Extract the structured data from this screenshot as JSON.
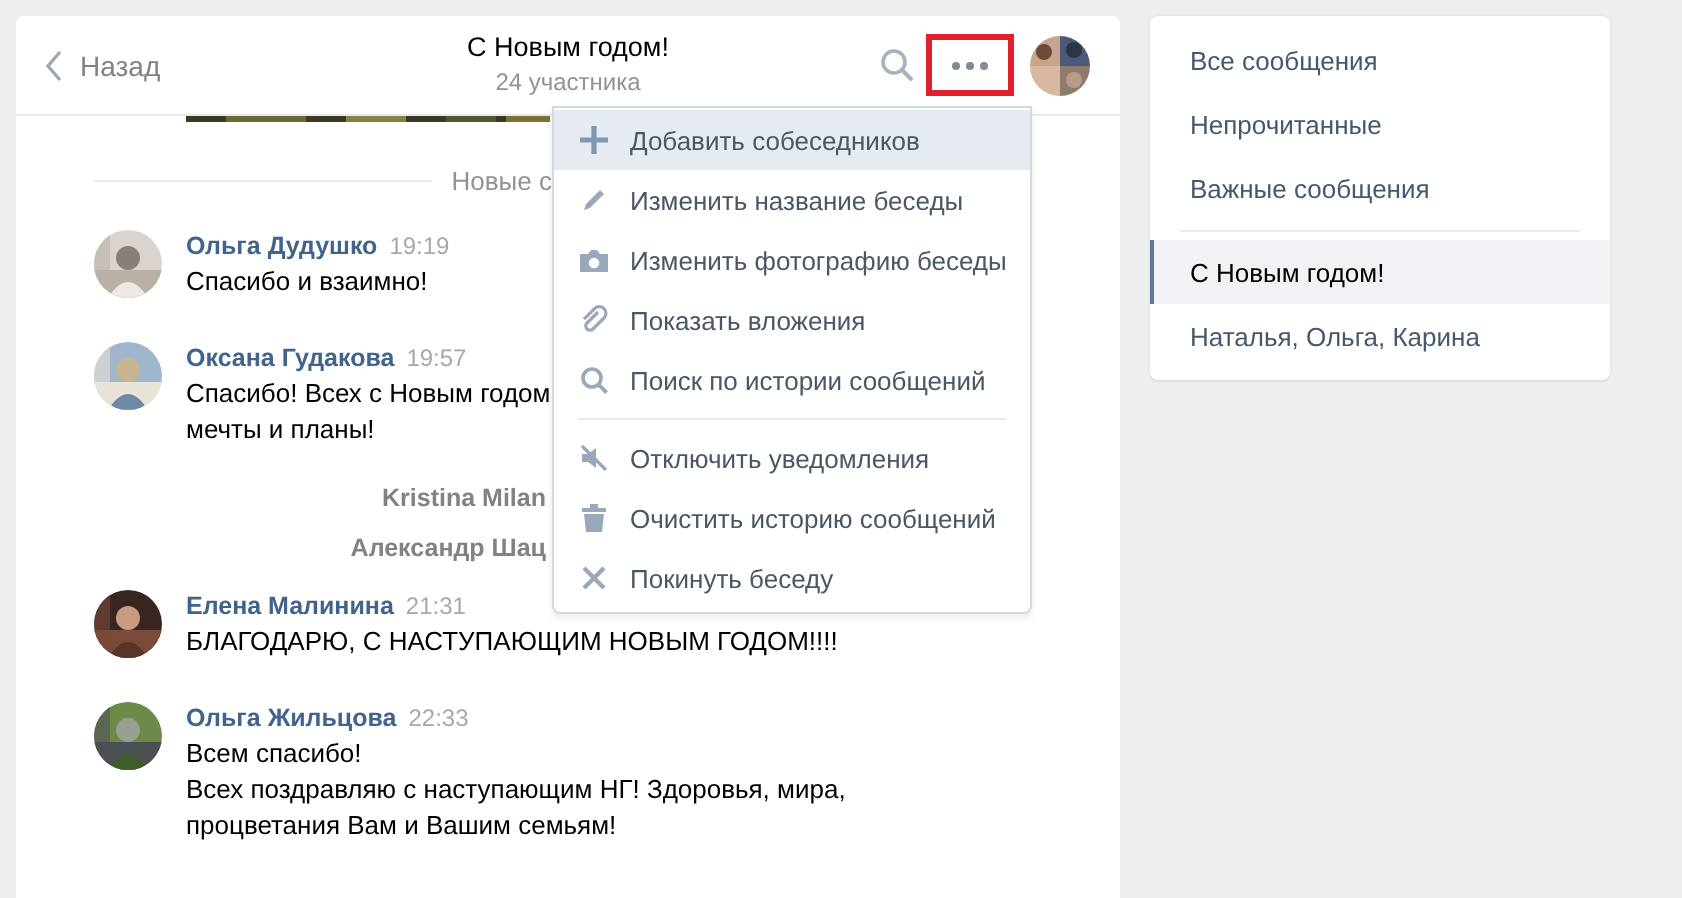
{
  "header": {
    "back": "Назад",
    "title": "С Новым годом!",
    "subtitle": "24 участника",
    "more_button": {
      "highlighted": true
    }
  },
  "new_divider": "Новые с",
  "messages": [
    {
      "kind": "message",
      "author": "Ольга Дудушко",
      "time": "19:19",
      "lines": [
        "Спасибо и взаимно!"
      ]
    },
    {
      "kind": "message",
      "author": "Оксана Гудакова",
      "time": "19:57",
      "lines": [
        "Спасибо! Всех с Новым годом",
        "мечты и планы!"
      ]
    },
    {
      "kind": "service",
      "author": "Kristina Milan"
    },
    {
      "kind": "service",
      "author": "Александр Шац"
    },
    {
      "kind": "message",
      "author": "Елена Малинина",
      "time": "21:31",
      "lines": [
        "БЛАГОДАРЮ, С НАСТУПАЮЩИМ НОВЫМ ГОДОМ!!!!"
      ]
    },
    {
      "kind": "message",
      "author": "Ольга Жильцова",
      "time": "22:33",
      "lines": [
        "Всем спасибо!",
        "Всех поздравляю с наступающим НГ! Здоровья, мира,",
        "процветания Вам и Вашим семьям!"
      ]
    }
  ],
  "menu": {
    "groups": [
      [
        {
          "label": "Добавить собеседников",
          "selected": true
        },
        {
          "label": "Изменить название беседы",
          "selected": false
        },
        {
          "label": "Изменить фотографию беседы",
          "selected": false
        },
        {
          "label": "Показать вложения",
          "selected": false
        },
        {
          "label": "Поиск по истории сообщений",
          "selected": false
        }
      ],
      [
        {
          "label": "Отключить уведомления",
          "selected": false
        },
        {
          "label": "Очистить историю сообщений",
          "selected": false
        },
        {
          "label": "Покинуть беседу",
          "selected": false
        }
      ]
    ]
  },
  "sidebar": {
    "groups": [
      [
        {
          "label": "Все сообщения",
          "selected": false
        },
        {
          "label": "Непрочитанные",
          "selected": false
        },
        {
          "label": "Важные сообщения",
          "selected": false
        }
      ],
      [
        {
          "label": "С Новым годом!",
          "selected": true
        },
        {
          "label": "Наталья, Ольга, Карина",
          "selected": false
        }
      ]
    ]
  }
}
